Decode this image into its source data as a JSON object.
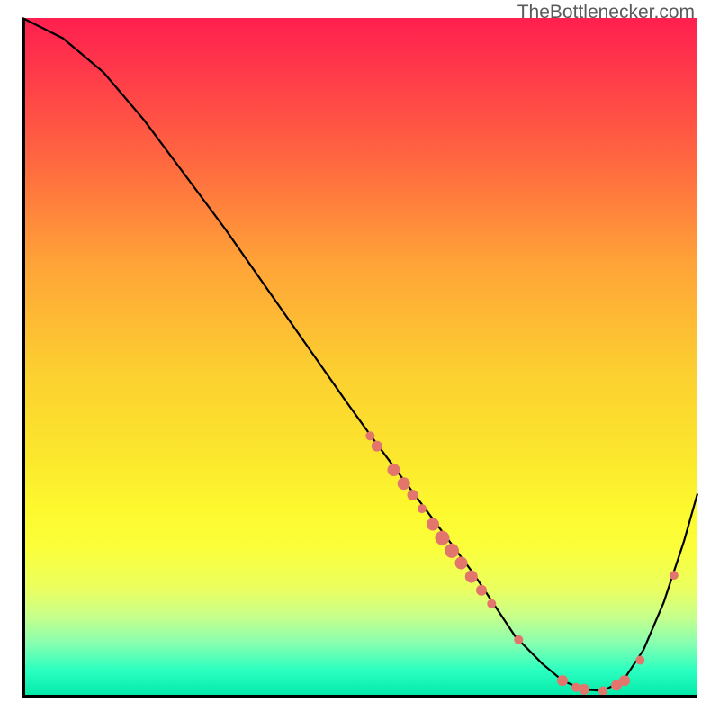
{
  "watermark": "TheBottlenecker.com",
  "chart_data": {
    "type": "line",
    "title": "",
    "xlabel": "",
    "ylabel": "",
    "xlim": [
      0,
      100
    ],
    "ylim": [
      0,
      100
    ],
    "background_gradient": {
      "top": "#ff1f4f",
      "mid": "#fde22d",
      "bottom": "#00e8a8"
    },
    "series": [
      {
        "name": "curve",
        "x": [
          0,
          6,
          12,
          18,
          24,
          30,
          36,
          42,
          48,
          52,
          55,
          58,
          61,
          64,
          67,
          70,
          73,
          77,
          80,
          83,
          86,
          89,
          92,
          95,
          98,
          100
        ],
        "y": [
          100,
          97,
          92,
          85,
          77,
          69,
          60.5,
          52,
          43.5,
          38,
          34,
          30,
          26,
          22,
          18,
          13.5,
          9,
          5,
          2.5,
          1.2,
          1.0,
          2.5,
          7,
          14,
          23,
          30
        ]
      }
    ],
    "markers": [
      {
        "x": 51.5,
        "y": 38.5,
        "r": 5
      },
      {
        "x": 52.5,
        "y": 37.0,
        "r": 6
      },
      {
        "x": 55.0,
        "y": 33.5,
        "r": 7
      },
      {
        "x": 56.5,
        "y": 31.5,
        "r": 7
      },
      {
        "x": 57.8,
        "y": 29.8,
        "r": 6
      },
      {
        "x": 59.2,
        "y": 27.8,
        "r": 5
      },
      {
        "x": 60.8,
        "y": 25.5,
        "r": 7
      },
      {
        "x": 62.2,
        "y": 23.5,
        "r": 8
      },
      {
        "x": 63.6,
        "y": 21.6,
        "r": 8
      },
      {
        "x": 65.0,
        "y": 19.8,
        "r": 7
      },
      {
        "x": 66.5,
        "y": 17.8,
        "r": 7
      },
      {
        "x": 68.0,
        "y": 15.8,
        "r": 6
      },
      {
        "x": 69.5,
        "y": 13.8,
        "r": 5
      },
      {
        "x": 73.5,
        "y": 8.5,
        "r": 5
      },
      {
        "x": 80.0,
        "y": 2.5,
        "r": 6
      },
      {
        "x": 82.0,
        "y": 1.5,
        "r": 5
      },
      {
        "x": 83.2,
        "y": 1.2,
        "r": 6
      },
      {
        "x": 86.0,
        "y": 1.0,
        "r": 5
      },
      {
        "x": 88.0,
        "y": 1.8,
        "r": 6
      },
      {
        "x": 89.2,
        "y": 2.5,
        "r": 6
      },
      {
        "x": 91.5,
        "y": 5.5,
        "r": 5
      },
      {
        "x": 96.5,
        "y": 18.0,
        "r": 5
      }
    ]
  }
}
